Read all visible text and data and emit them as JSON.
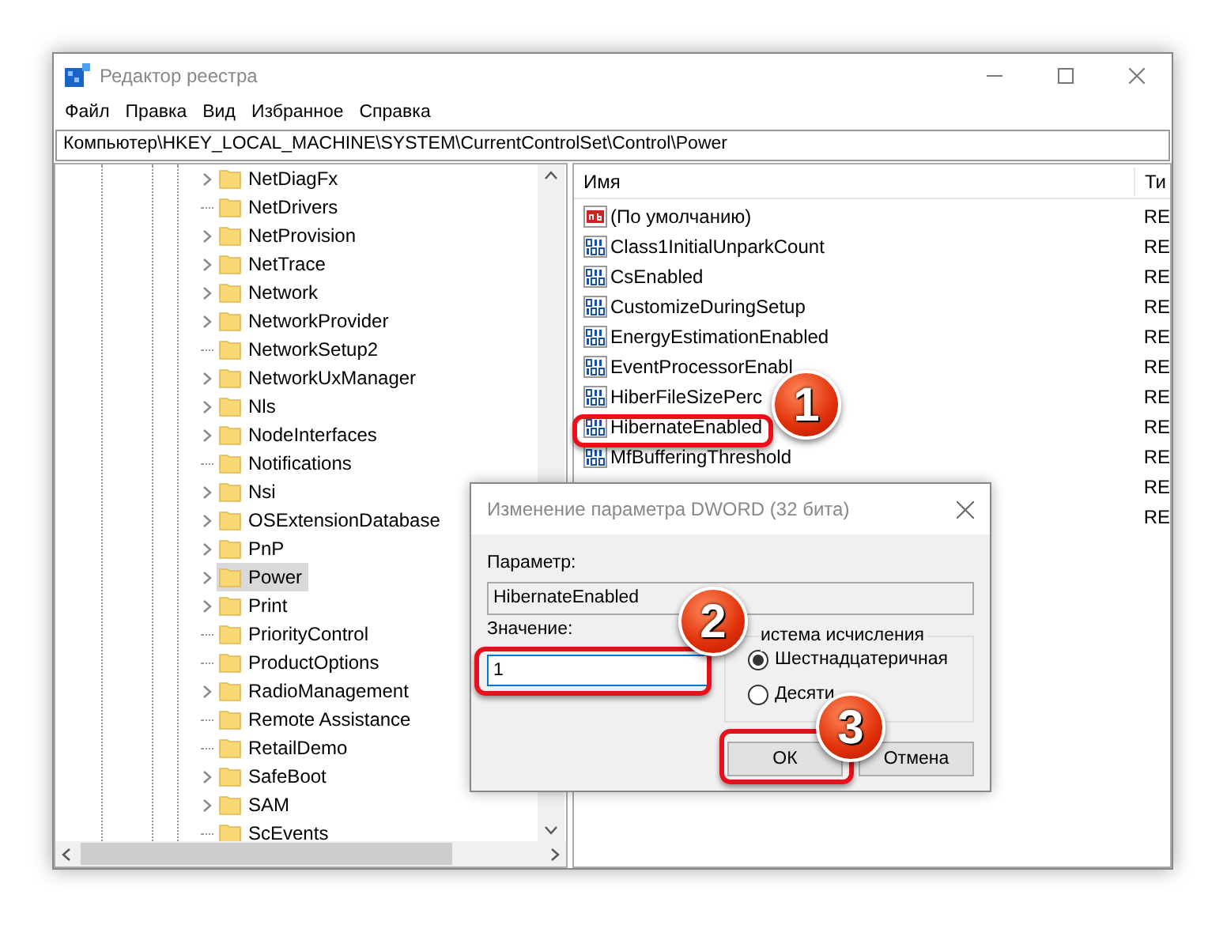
{
  "window": {
    "title": "Редактор реестра"
  },
  "menu": [
    "Файл",
    "Правка",
    "Вид",
    "Избранное",
    "Справка"
  ],
  "address": "Компьютер\\HKEY_LOCAL_MACHINE\\SYSTEM\\CurrentControlSet\\Control\\Power",
  "tree": [
    {
      "label": "NetDiagFx",
      "expandable": true,
      "selected": false
    },
    {
      "label": "NetDrivers",
      "expandable": false,
      "selected": false
    },
    {
      "label": "NetProvision",
      "expandable": true,
      "selected": false
    },
    {
      "label": "NetTrace",
      "expandable": true,
      "selected": false
    },
    {
      "label": "Network",
      "expandable": true,
      "selected": false
    },
    {
      "label": "NetworkProvider",
      "expandable": true,
      "selected": false
    },
    {
      "label": "NetworkSetup2",
      "expandable": false,
      "selected": false
    },
    {
      "label": "NetworkUxManager",
      "expandable": true,
      "selected": false
    },
    {
      "label": "Nls",
      "expandable": true,
      "selected": false
    },
    {
      "label": "NodeInterfaces",
      "expandable": true,
      "selected": false
    },
    {
      "label": "Notifications",
      "expandable": false,
      "selected": false
    },
    {
      "label": "Nsi",
      "expandable": true,
      "selected": false
    },
    {
      "label": "OSExtensionDatabase",
      "expandable": true,
      "selected": false
    },
    {
      "label": "PnP",
      "expandable": true,
      "selected": false
    },
    {
      "label": "Power",
      "expandable": true,
      "selected": true
    },
    {
      "label": "Print",
      "expandable": true,
      "selected": false
    },
    {
      "label": "PriorityControl",
      "expandable": false,
      "selected": false
    },
    {
      "label": "ProductOptions",
      "expandable": false,
      "selected": false
    },
    {
      "label": "RadioManagement",
      "expandable": true,
      "selected": false
    },
    {
      "label": "Remote Assistance",
      "expandable": false,
      "selected": false
    },
    {
      "label": "RetailDemo",
      "expandable": false,
      "selected": false
    },
    {
      "label": "SafeBoot",
      "expandable": true,
      "selected": false
    },
    {
      "label": "SAM",
      "expandable": true,
      "selected": false
    },
    {
      "label": "ScEvents",
      "expandable": false,
      "selected": false
    }
  ],
  "values": {
    "columns": [
      "Имя",
      "Ти"
    ],
    "rows": [
      {
        "kind": "string",
        "name": "(По умолчанию)",
        "type": "RE"
      },
      {
        "kind": "dword",
        "name": "Class1InitialUnparkCount",
        "type": "RE"
      },
      {
        "kind": "dword",
        "name": "CsEnabled",
        "type": "RE"
      },
      {
        "kind": "dword",
        "name": "CustomizeDuringSetup",
        "type": "RE"
      },
      {
        "kind": "dword",
        "name": "EnergyEstimationEnabled",
        "type": "RE"
      },
      {
        "kind": "dword",
        "name": "EventProcessorEnabl",
        "type": "RE"
      },
      {
        "kind": "dword",
        "name": "HiberFileSizePerc",
        "type": "RE"
      },
      {
        "kind": "dword",
        "name": "HibernateEnabled",
        "type": "RE"
      },
      {
        "kind": "dword",
        "name": "MfBufferingThreshold",
        "type": "RE"
      },
      {
        "kind": "hidden",
        "type": "RE"
      },
      {
        "kind": "hidden",
        "type": "RE"
      }
    ]
  },
  "dialog": {
    "title": "Изменение параметра DWORD (32 бита)",
    "param_label": "Параметр:",
    "param_value": "HibernateEnabled",
    "value_label": "Значение:",
    "value": "1",
    "base_group": "истема исчисления",
    "radios": [
      {
        "label": "Шестнадцатеричная",
        "selected": true
      },
      {
        "label": "Десяти",
        "selected": false
      }
    ],
    "buttons": [
      "ОК",
      "Отмена"
    ]
  },
  "callouts": [
    "1",
    "2",
    "3"
  ]
}
